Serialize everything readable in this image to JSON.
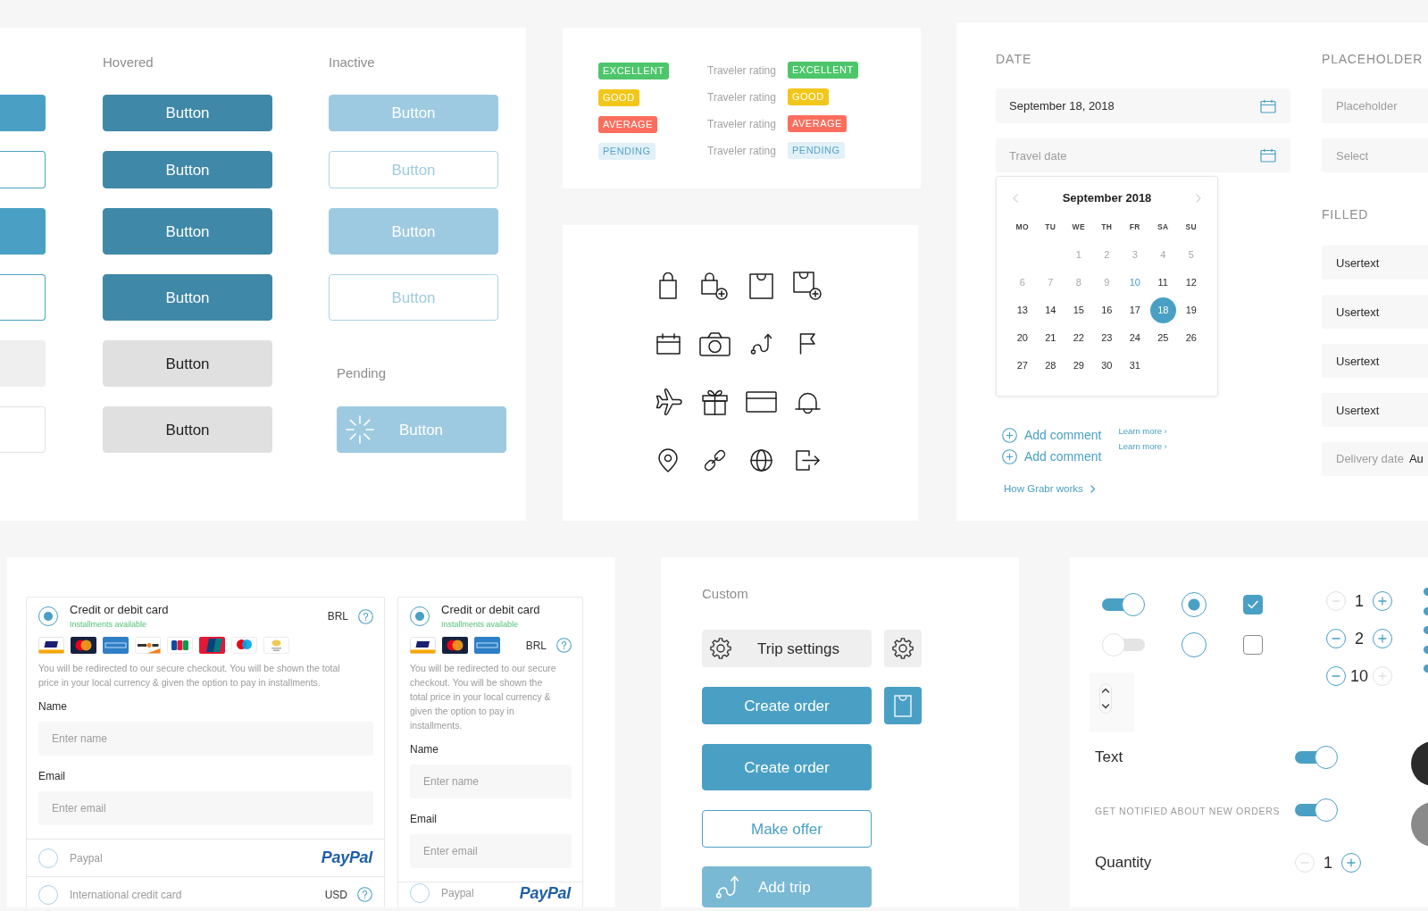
{
  "button_states": {
    "columns": [
      {
        "kind": "default",
        "buttons": [
          {
            "kind": "primary"
          },
          {
            "kind": "outline"
          },
          {
            "kind": "primary"
          },
          {
            "kind": "outline"
          },
          {
            "kind": "secondary"
          },
          {
            "kind": "ghost"
          }
        ]
      },
      {
        "heading": "Hovered",
        "kind": "hovered",
        "buttons": [
          {
            "kind": "primary",
            "label": "Button"
          },
          {
            "kind": "outline",
            "label": "Button"
          },
          {
            "kind": "primary",
            "label": "Button"
          },
          {
            "kind": "outline",
            "label": "Button"
          },
          {
            "kind": "secondary",
            "label": "Button"
          },
          {
            "kind": "ghost",
            "label": "Button"
          }
        ]
      },
      {
        "heading": "Inactive",
        "kind": "inactive",
        "buttons": [
          {
            "kind": "primary",
            "label": "Button"
          },
          {
            "kind": "outline",
            "label": "Button"
          },
          {
            "kind": "primary",
            "label": "Button"
          },
          {
            "kind": "outline",
            "label": "Button"
          }
        ],
        "pending": {
          "heading": "Pending",
          "kind": "pending",
          "button": {
            "kind": "primary",
            "label": "Button"
          }
        }
      }
    ]
  },
  "rating_badges": [
    {
      "badge": "EXCELLENT",
      "caption": "Traveler rating",
      "rating": "EXCELLENT",
      "color": "#4dc66b"
    },
    {
      "badge": "GOOD",
      "caption": "Traveler rating",
      "rating": "GOOD",
      "color": "#f2c71c"
    },
    {
      "badge": "AVERAGE",
      "caption": "Traveler rating",
      "rating": "AVERAGE",
      "color": "#fb6e5e"
    },
    {
      "badge": "PENDING",
      "caption": "Traveler rating",
      "rating": "PENDING",
      "color": "#e2f0f8"
    }
  ],
  "date_picker": {
    "heading": "DATE",
    "fields": [
      {
        "value": "September 18, 2018"
      },
      {
        "placeholder": "Travel date"
      }
    ],
    "calendar": {
      "title": "September 2018",
      "weekdays": [
        "MO",
        "TU",
        "WE",
        "TH",
        "FR",
        "SA",
        "SU"
      ],
      "weeks": [
        {
          "kind": "first",
          "days": [
            {
              "day": "1",
              "disabled": true,
              "today": false,
              "selected": false
            },
            {
              "day": "2",
              "disabled": true,
              "today": false,
              "selected": false
            },
            {
              "day": "3",
              "disabled": true,
              "today": false,
              "selected": false
            },
            {
              "day": "4",
              "disabled": true,
              "today": false,
              "selected": false
            },
            {
              "day": "5",
              "disabled": true,
              "today": false,
              "selected": false
            }
          ]
        },
        {
          "kind": "full",
          "days": [
            {
              "day": "6",
              "disabled": true,
              "today": false,
              "selected": false
            },
            {
              "day": "7",
              "disabled": true,
              "today": false,
              "selected": false
            },
            {
              "day": "8",
              "disabled": true,
              "today": false,
              "selected": false
            },
            {
              "day": "9",
              "disabled": true,
              "today": false,
              "selected": false
            },
            {
              "day": "10",
              "disabled": false,
              "today": true,
              "selected": false
            },
            {
              "day": "11",
              "disabled": false,
              "today": false,
              "selected": false
            },
            {
              "day": "12",
              "disabled": false,
              "today": false,
              "selected": false
            }
          ]
        },
        {
          "kind": "full",
          "days": [
            {
              "day": "13",
              "disabled": false,
              "today": false,
              "selected": false
            },
            {
              "day": "14",
              "disabled": false,
              "today": false,
              "selected": false
            },
            {
              "day": "15",
              "disabled": false,
              "today": false,
              "selected": false
            },
            {
              "day": "16",
              "disabled": false,
              "today": false,
              "selected": false
            },
            {
              "day": "17",
              "disabled": false,
              "today": false,
              "selected": false
            },
            {
              "day": "18",
              "disabled": false,
              "today": false,
              "selected": true
            },
            {
              "day": "19",
              "disabled": false,
              "today": false,
              "selected": false
            }
          ]
        },
        {
          "kind": "full",
          "days": [
            {
              "day": "20",
              "disabled": false,
              "today": false,
              "selected": false
            },
            {
              "day": "21",
              "disabled": false,
              "today": false,
              "selected": false
            },
            {
              "day": "22",
              "disabled": false,
              "today": false,
              "selected": false
            },
            {
              "day": "23",
              "disabled": false,
              "today": false,
              "selected": false
            },
            {
              "day": "24",
              "disabled": false,
              "today": false,
              "selected": false
            },
            {
              "day": "25",
              "disabled": false,
              "today": false,
              "selected": false
            },
            {
              "day": "26",
              "disabled": false,
              "today": false,
              "selected": false
            }
          ]
        },
        {
          "kind": "last",
          "days": [
            {
              "day": "27",
              "disabled": false,
              "today": false,
              "selected": false
            },
            {
              "day": "28",
              "disabled": false,
              "today": false,
              "selected": false
            },
            {
              "day": "29",
              "disabled": false,
              "today": false,
              "selected": false
            },
            {
              "day": "30",
              "disabled": false,
              "today": false,
              "selected": false
            },
            {
              "day": "31",
              "disabled": false,
              "today": false,
              "selected": false
            }
          ]
        }
      ]
    },
    "comment_links": [
      "Add comment",
      "Add comment"
    ],
    "learn_more_links": [
      "Learn more ›",
      "Learn more ›"
    ],
    "how_it_works_link": "How Grabr works"
  },
  "text_fields": {
    "placeholder_heading": "PLACEHOLDER",
    "placeholder_fields": [
      {
        "placeholder": "Placeholder"
      },
      {
        "placeholder": "Select"
      }
    ],
    "filled_heading": "FILLED",
    "filled_fields": [
      {
        "value": "Usertext"
      },
      {
        "value": "Usertext"
      },
      {
        "value": "Usertext"
      },
      {
        "value": "Usertext"
      },
      {
        "label": "Delivery date",
        "value": "Au"
      }
    ]
  },
  "payment_forms": [
    {
      "options": [
        {
          "kind": "card",
          "selected": true,
          "title": "Credit or debit card",
          "note": "Installments available",
          "currency": "BRL",
          "brands": [
            {
              "kind": "visa"
            },
            {
              "kind": "mastercard"
            },
            {
              "kind": "amex"
            },
            {
              "kind": "discover"
            },
            {
              "kind": "jcb"
            },
            {
              "kind": "unionpay"
            },
            {
              "kind": "maestro"
            },
            {
              "kind": "other"
            }
          ],
          "description": "You will be redirected to our secure checkout. You will be shown the total price in your local currency & given the option to pay in installments.",
          "fields": [
            {
              "label": "Name",
              "placeholder": "Enter name"
            },
            {
              "label": "Email",
              "placeholder": "Enter email"
            }
          ]
        },
        {
          "kind": "paypal",
          "selected": false,
          "title": "Paypal",
          "logo": "PayPal"
        },
        {
          "kind": "plain",
          "selected": false,
          "title": "International credit card",
          "currency": "USD"
        }
      ]
    },
    {
      "options": [
        {
          "kind": "card",
          "selected": true,
          "title": "Credit or debit card",
          "note": "Installments available",
          "currency": "BRL",
          "brands": [
            {
              "kind": "visa"
            },
            {
              "kind": "mastercard"
            },
            {
              "kind": "amex"
            }
          ],
          "description": "You will be redirected to our secure checkout. You will be shown the total price in your local currency & given the option to pay in installments.",
          "fields": [
            {
              "label": "Name",
              "placeholder": "Enter name"
            },
            {
              "label": "Email",
              "placeholder": "Enter email"
            }
          ]
        },
        {
          "kind": "paypal",
          "selected": false,
          "title": "Paypal",
          "logo": "PayPal"
        }
      ]
    }
  ],
  "custom_buttons": {
    "heading": "Custom",
    "rows": [
      {
        "button": {
          "kind": "secondary",
          "label": "Trip settings"
        },
        "icon_button": {
          "kind": "secondary"
        }
      },
      {
        "button": {
          "kind": "primary",
          "label": "Create order"
        },
        "icon_button": {
          "kind": "primary"
        }
      },
      {
        "button": {
          "kind": "primary",
          "label": "Create order"
        }
      },
      {
        "button": {
          "kind": "outline",
          "label": "Make offer"
        }
      },
      {
        "button": {
          "kind": "light",
          "label": "Add trip"
        }
      }
    ]
  },
  "controls": {
    "toggles": [
      {
        "on": true
      },
      {
        "on": false
      }
    ],
    "radios": [
      {
        "selected": true
      },
      {
        "selected": false
      }
    ],
    "checkboxes": [
      {
        "checked": true
      },
      {
        "checked": false
      }
    ],
    "steppers": [
      {
        "value": "1",
        "minus_disabled": true,
        "plus_disabled": false
      },
      {
        "value": "2",
        "minus_disabled": false,
        "plus_disabled": false
      },
      {
        "value": "10",
        "minus_disabled": false,
        "plus_disabled": true
      }
    ],
    "settings": [
      {
        "kind": "toggle",
        "label": "Text",
        "on": true
      },
      {
        "kind": "caption_toggle",
        "label": "GET NOTIFIED ABOUT NEW ORDERS",
        "on": true
      },
      {
        "kind": "stepper",
        "label": "Quantity",
        "value": "1",
        "minus_disabled": true,
        "plus_disabled": false
      }
    ],
    "swatches": [
      {
        "color": "#2b2b2b"
      },
      {
        "color": "#8a8a8a"
      }
    ]
  }
}
